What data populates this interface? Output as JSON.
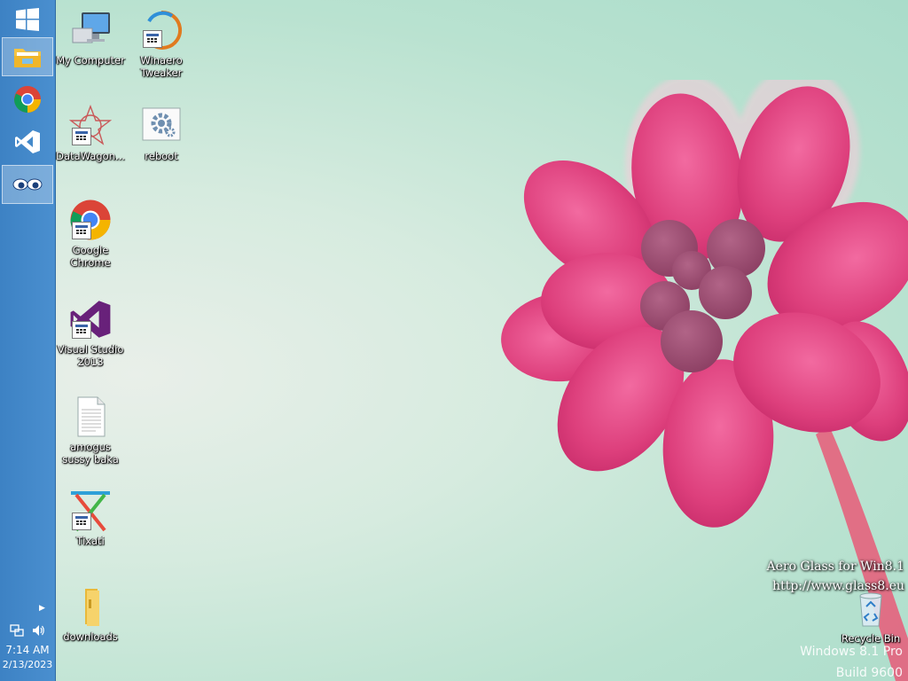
{
  "taskbar": {
    "buttons": [
      {
        "name": "start-button",
        "icon": "windows-logo-icon"
      },
      {
        "name": "file-explorer",
        "icon": "folder-icon"
      },
      {
        "name": "chrome",
        "icon": "chrome-icon"
      },
      {
        "name": "visual-studio",
        "icon": "visual-studio-icon"
      },
      {
        "name": "eyes-app",
        "icon": "eyes-icon"
      }
    ],
    "tray": {
      "time": "7:14 AM",
      "date": "2/13/2023"
    }
  },
  "desktop": {
    "icons": [
      {
        "label": "My Computer",
        "icon": "computer-icon"
      },
      {
        "label": "Winaero Tweaker",
        "icon": "winaero-icon"
      },
      {
        "label": "DataWagon...",
        "icon": "datawagon-icon"
      },
      {
        "label": "reboot",
        "icon": "gear-icon"
      },
      {
        "label": "Google Chrome",
        "icon": "chrome-icon"
      },
      {
        "label": "Visual Studio 2013",
        "icon": "visual-studio-icon"
      },
      {
        "label": "amogus sussy baka",
        "icon": "text-file-icon"
      },
      {
        "label": "Tixati",
        "icon": "tixati-icon"
      },
      {
        "label": "downloads",
        "icon": "folder-icon"
      },
      {
        "label": "Recycle Bin",
        "icon": "recycle-bin-icon"
      }
    ]
  },
  "watermark": {
    "line1": "Aero Glass for Win8.1",
    "line2": "http://www.glass8.eu",
    "os": "Windows 8.1 Pro",
    "build": "Build 9600"
  },
  "colors": {
    "taskbar": "#4a8fcf",
    "flower": "#e0457f",
    "background": "#b9e2d0"
  }
}
